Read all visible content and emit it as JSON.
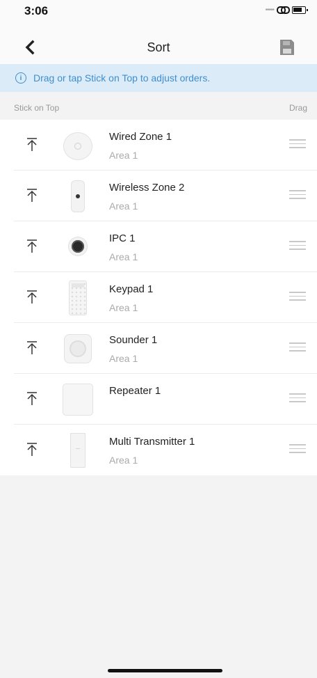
{
  "status_bar": {
    "time": "3:06"
  },
  "nav": {
    "title": "Sort"
  },
  "banner": {
    "icon": "info-icon",
    "text": "Drag or tap Stick on Top to adjust orders."
  },
  "list_header": {
    "left": "Stick on Top",
    "right": "Drag"
  },
  "devices": [
    {
      "name": "Wired Zone 1",
      "area": "Area 1",
      "image": "wired-zone-image"
    },
    {
      "name": "Wireless Zone 2",
      "area": "Area 1",
      "image": "pir-detector-image"
    },
    {
      "name": "IPC 1",
      "area": "Area 1",
      "image": "ipc-camera-image"
    },
    {
      "name": "Keypad 1",
      "area": "Area 1",
      "image": "keypad-image"
    },
    {
      "name": "Sounder 1",
      "area": "Area 1",
      "image": "sounder-image"
    },
    {
      "name": "Repeater 1",
      "area": "",
      "image": "repeater-image"
    },
    {
      "name": "Multi Transmitter 1",
      "area": "Area 1",
      "image": "multi-transmitter-image"
    }
  ],
  "colors": {
    "accent": "#3d8fd0",
    "banner_bg": "#dcebf8",
    "page_bg": "#f3f3f3"
  }
}
